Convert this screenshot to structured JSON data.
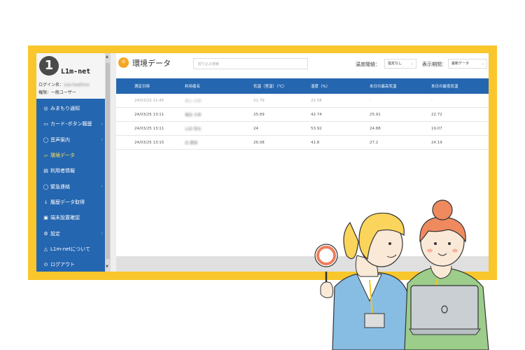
{
  "app": {
    "logo_text": "L1m-net",
    "logo_number": "1"
  },
  "user": {
    "login_label": "ログイン名：",
    "login_name": "xxx-hoshino",
    "role": "権限：一般ユーザー"
  },
  "sidebar": {
    "items": [
      {
        "label": "みまもり通知",
        "icon": "eye-icon",
        "arrow": false
      },
      {
        "label": "カード･ボタン履歴",
        "icon": "card-icon",
        "arrow": true
      },
      {
        "label": "音声案内",
        "icon": "speech-bubble-icon",
        "arrow": true
      },
      {
        "label": "環境データ",
        "icon": "folder-icon",
        "arrow": false,
        "active": true
      },
      {
        "label": "利用者情報",
        "icon": "document-icon",
        "arrow": false
      },
      {
        "label": "緊急連絡",
        "icon": "speech-bubble-icon",
        "arrow": true
      },
      {
        "label": "履歴データ取得",
        "icon": "download-icon",
        "arrow": false
      },
      {
        "label": "端末設置確認",
        "icon": "file-check-icon",
        "arrow": false
      },
      {
        "label": "設定",
        "icon": "gear-icon",
        "arrow": true
      },
      {
        "label": "L1m-netについて",
        "icon": "cloud-icon",
        "arrow": false
      },
      {
        "label": "ログアウト",
        "icon": "logout-icon",
        "arrow": false
      }
    ]
  },
  "header": {
    "title": "環境データ",
    "search_placeholder": "絞り込み検索",
    "threshold_label": "温度閾値：",
    "threshold_value": "指定なし",
    "period_label": "表示期間：",
    "period_value": "最新データ"
  },
  "table": {
    "columns": [
      "測定日時",
      "利用者名",
      "気温（室温）（℃）",
      "湿度（%）",
      "本日の最高気温",
      "本日の最低気温"
    ],
    "rows": [
      {
        "date": "24/03/22 11:45",
        "name": "島山 太郎",
        "temp": "21.79",
        "humidity": "22.58",
        "max": "-",
        "min": "-",
        "faded": true
      },
      {
        "date": "24/03/25 13:11",
        "name": "増田 大郎",
        "temp": "25.69",
        "humidity": "42.74",
        "max": "25.91",
        "min": "22.72"
      },
      {
        "date": "24/03/25 13:11",
        "name": "山田 翔太",
        "temp": "24",
        "humidity": "53.92",
        "max": "24.88",
        "min": "19.07"
      },
      {
        "date": "24/03/25 13:15",
        "name": "田 慶樹",
        "temp": "26.08",
        "humidity": "41.8",
        "max": "27.2",
        "min": "24.19"
      }
    ]
  },
  "colors": {
    "frame": "#f9c62c",
    "sidebar": "#2566b0",
    "accent": "#f5a623",
    "active_nav": "#ffe15b"
  }
}
